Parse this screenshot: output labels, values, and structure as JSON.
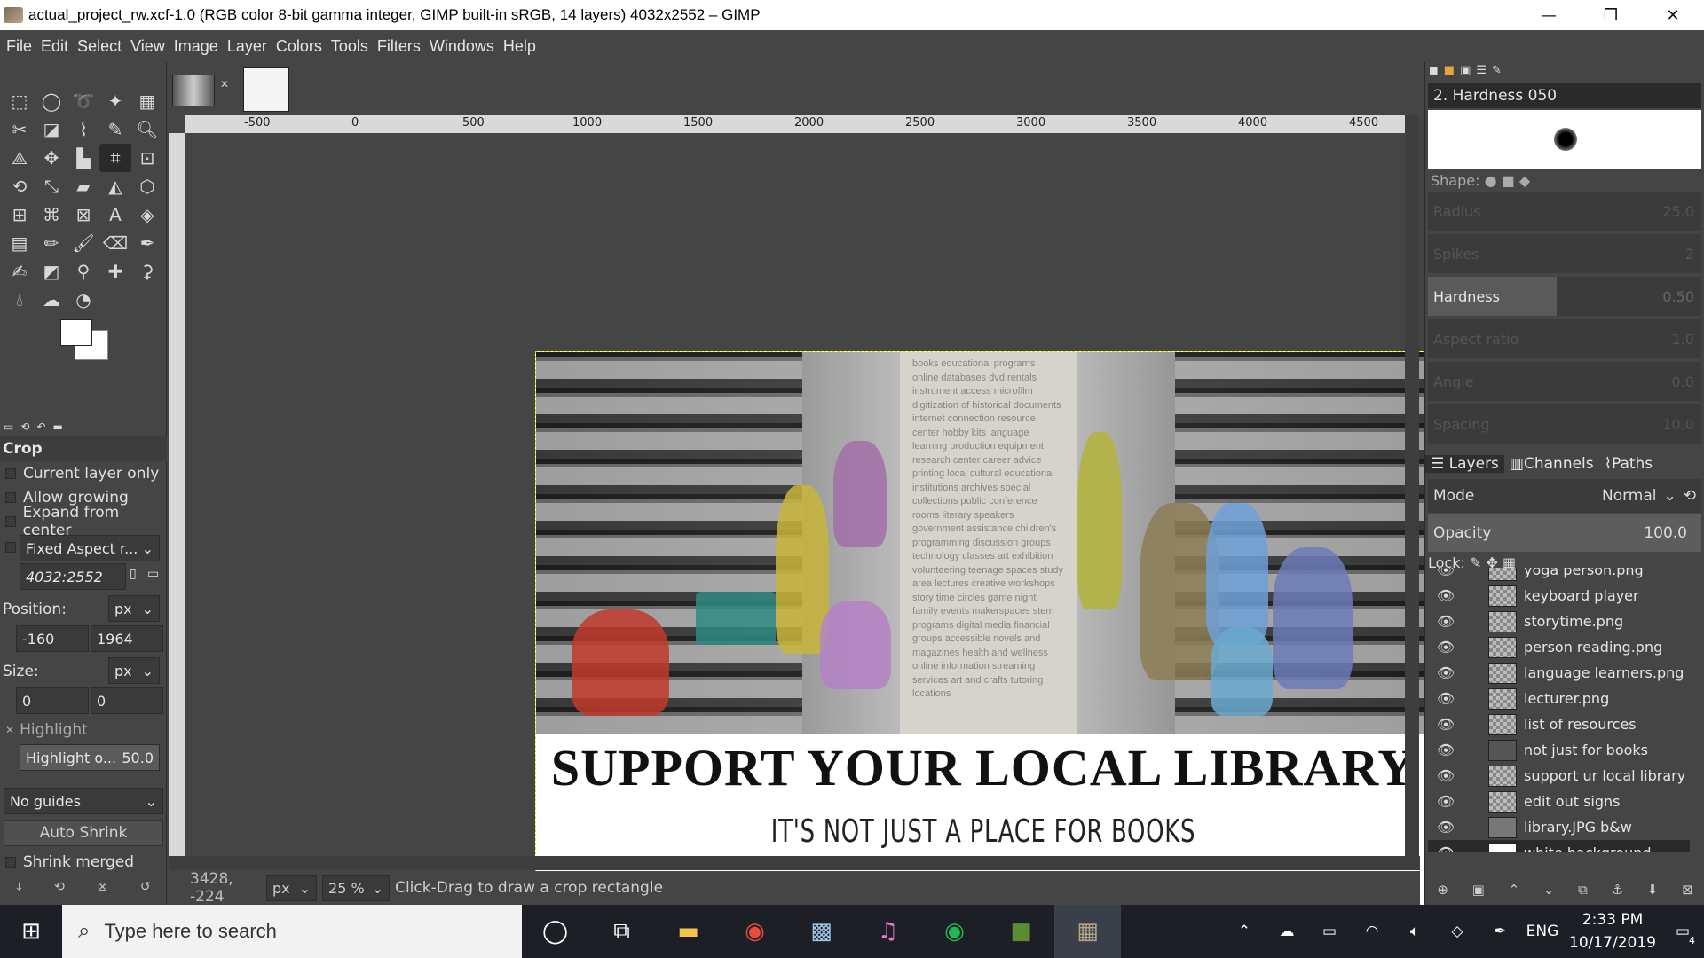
{
  "window": {
    "title": "actual_project_rw.xcf-1.0 (RGB color 8-bit gamma integer, GIMP built-in sRGB, 14 layers) 4032x2552 – GIMP",
    "controls": [
      "—",
      "❐",
      "✕"
    ]
  },
  "menu": [
    "File",
    "Edit",
    "Select",
    "View",
    "Image",
    "Layer",
    "Colors",
    "Tools",
    "Filters",
    "Windows",
    "Help"
  ],
  "toolbox": {
    "tools": [
      "rect-select",
      "ellipse-select",
      "free-select",
      "fuzzy-select",
      "select-by-color",
      "scissors",
      "foreground-select",
      "paths",
      "color-picker",
      "zoom",
      "measure",
      "move",
      "align",
      "crop",
      "unified-transform",
      "rotate",
      "scale",
      "shear",
      "flip",
      "perspective",
      "cage",
      "warp",
      "handle-transform",
      "text",
      "bucket-fill",
      "blend",
      "pencil",
      "paintbrush",
      "eraser",
      "airbrush",
      "ink",
      "mypaint",
      "clone",
      "heal",
      "perspective-clone",
      "smudge",
      "blur",
      "dodge"
    ]
  },
  "tool_options": {
    "title": "Crop",
    "checks": [
      "Current layer only",
      "Allow growing",
      "Expand from center"
    ],
    "fixed_aspect": "Fixed Aspect r...",
    "aspect_value": "4032:2552",
    "position_label": "Position:",
    "position_unit": "px",
    "position_x": "-160",
    "position_y": "1964",
    "size_label": "Size:",
    "size_unit": "px",
    "size_w": "0",
    "size_h": "0",
    "highlight": "Highlight",
    "highlight_opacity_label": "Highlight o...",
    "highlight_opacity_value": "50.0",
    "guides": "No guides",
    "auto_shrink": "Auto Shrink",
    "shrink_merged": "Shrink merged"
  },
  "ruler": {
    "top_labels": [
      "-500",
      "0",
      "500",
      "1000",
      "1500",
      "2000",
      "2500",
      "3000",
      "3500",
      "4000",
      "4500"
    ]
  },
  "poster": {
    "title": "SUPPORT YOUR LOCAL LIBRARY",
    "subtitle": "IT'S NOT JUST A PLACE FOR BOOKS",
    "pillar_text": "books educational programs online databases dvd rentals instrument access microfilm digitization of historical documents internet connection resource center hobby kits language learning production equipment research center career advice printing local cultural educational institutions archives special collections public conference rooms literary speakers government assistance children's programming discussion groups technology classes art exhibition volunteering teenage spaces study area lectures creative workshops story time circles game night family events makerspaces stem programs digital media financial groups accessible novels and magazines health and wellness online information streaming services art and crafts tutoring locations"
  },
  "statusbar": {
    "coords": "3428, -224",
    "unit": "px",
    "zoom": "25 %",
    "message": "Click-Drag to draw a crop rectangle"
  },
  "brushes": {
    "name": "2. Hardness 050",
    "shape_label": "Shape:",
    "sliders": [
      {
        "label": "Radius",
        "value": "25.0"
      },
      {
        "label": "Spikes",
        "value": "2"
      },
      {
        "label": "Hardness",
        "value": "0.50"
      },
      {
        "label": "Aspect ratio",
        "value": "1.0"
      },
      {
        "label": "Angle",
        "value": "0.0"
      },
      {
        "label": "Spacing",
        "value": "10.0"
      }
    ]
  },
  "layers_panel": {
    "tabs": [
      "Layers",
      "Channels",
      "Paths"
    ],
    "mode_label": "Mode",
    "mode_value": "Normal",
    "opacity_label": "Opacity",
    "opacity_value": "100.0",
    "lock_label": "Lock:",
    "layers": [
      "yoga person.png",
      "keyboard player",
      "storytime.png",
      "person reading.png",
      "language learners.png",
      "lecturer.png",
      "list of resources",
      "not just for books",
      "support ur local library",
      "edit out signs",
      "library.JPG b&w",
      "white background"
    ],
    "selected": "white background"
  },
  "taskbar": {
    "search_placeholder": "Type here to search",
    "language": "ENG",
    "time": "2:33 PM",
    "date": "10/17/2019",
    "notifications": "4"
  }
}
